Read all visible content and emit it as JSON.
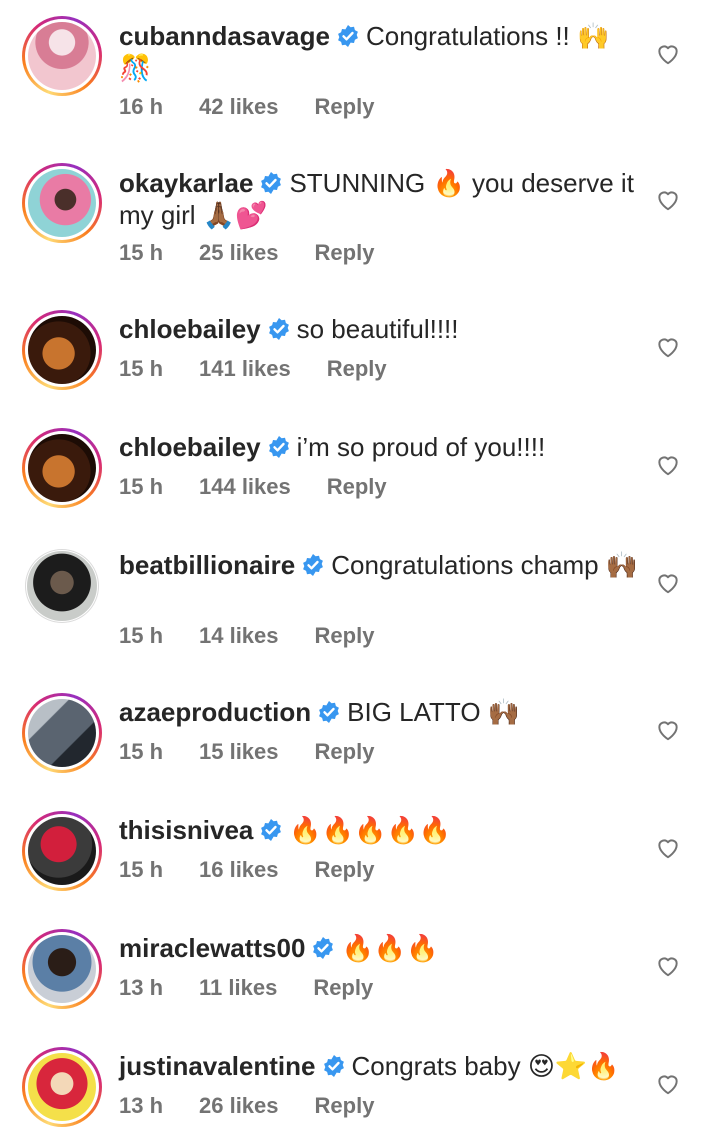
{
  "comments": [
    {
      "username": "cubanndasavage",
      "text": "Congratulations !! 🙌🎊",
      "time": "16 h",
      "likes": "42 likes",
      "reply": "Reply",
      "avatar_colors": [
        "#f2c6cf",
        "#d87d95",
        "#f6e3e8"
      ],
      "story": true
    },
    {
      "username": "okaykarlae",
      "text": "STUNNING 🔥 you deserve it my girl 🙏🏾💕",
      "time": "15 h",
      "likes": "25 likes",
      "reply": "Reply",
      "avatar_colors": [
        "#8fd3d6",
        "#e97ba5",
        "#4a2f2a"
      ],
      "story": true
    },
    {
      "username": "chloebailey",
      "text": "so beautiful!!!!",
      "time": "15 h",
      "likes": "141 likes",
      "reply": "Reply",
      "avatar_colors": [
        "#3a1a0c",
        "#c8742e",
        "#1d0c05"
      ],
      "story": true
    },
    {
      "username": "chloebailey",
      "text": "i’m so proud of you!!!!",
      "time": "15 h",
      "likes": "144 likes",
      "reply": "Reply",
      "avatar_colors": [
        "#3a1a0c",
        "#c8742e",
        "#1d0c05"
      ],
      "story": true
    },
    {
      "username": "beatbillionaire",
      "text": "Congratulations champ 🙌🏾",
      "time": "15 h",
      "likes": "14 likes",
      "reply": "Reply",
      "avatar_colors": [
        "#c9ccc9",
        "#1c1c1c",
        "#6b5a4c"
      ],
      "story": false
    },
    {
      "username": "azaeproduction",
      "text": "BIG LATTO 🙌🏾",
      "time": "15 h",
      "likes": "15 likes",
      "reply": "Reply",
      "avatar_colors": [
        "#5a6470",
        "#22272e",
        "#b8bfc6"
      ],
      "story": true
    },
    {
      "username": "thisisnivea",
      "text": "🔥🔥🔥🔥🔥",
      "time": "15 h",
      "likes": "16 likes",
      "reply": "Reply",
      "avatar_colors": [
        "#1a1a1a",
        "#d21f3c",
        "#3b3b3b"
      ],
      "story": true
    },
    {
      "username": "miraclewatts00",
      "text": "🔥🔥🔥",
      "time": "13 h",
      "likes": "11 likes",
      "reply": "Reply",
      "avatar_colors": [
        "#c9ced6",
        "#2a1d17",
        "#5b7fa6"
      ],
      "story": true
    },
    {
      "username": "justinavalentine",
      "text": "Congrats baby 😍⭐🔥",
      "time": "13 h",
      "likes": "26 likes",
      "reply": "Reply",
      "avatar_colors": [
        "#f4e04a",
        "#d8263c",
        "#f3d8b8"
      ],
      "story": true
    }
  ],
  "colors": {
    "verified": "#3897f0",
    "meta": "#737373",
    "text": "#262626"
  }
}
